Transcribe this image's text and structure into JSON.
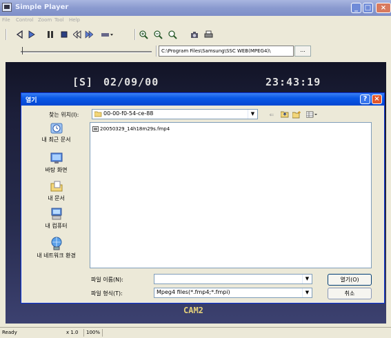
{
  "app": {
    "title": "Simple Player",
    "path": "C:\\Program Files\\Samsung\\SSC WEB(MPEG4)\\",
    "browse_label": "..."
  },
  "window_controls": {
    "minimize": "_",
    "maximize": "□",
    "close": "×"
  },
  "menu": [
    "File",
    "Control",
    "Zoom",
    "Tool",
    "Help"
  ],
  "toolbar_icons": [
    "rewind-icon",
    "play-icon",
    "pause-icon",
    "stop-icon",
    "step-back-icon",
    "step-forward-icon",
    "speed-dropdown-icon",
    "zoom-in-icon",
    "zoom-out-icon",
    "search-icon",
    "snapshot-icon",
    "print-icon"
  ],
  "video": {
    "ch": "[S]",
    "date": "02/09/00",
    "time": "23:43:19",
    "camera": "CAM2"
  },
  "dialog": {
    "title": "열기",
    "help": "?",
    "close": "×",
    "look_in_label": "찾는 위치(I):",
    "look_in_value": "00-00-f0-54-ce-88",
    "places": [
      "내 최근 문서",
      "바탕 화면",
      "내 문서",
      "내 컴퓨터",
      "내 네트워크 환경"
    ],
    "files": [
      "20050329_14h18m29s.fmp4"
    ],
    "filename_label": "파일 이름(N):",
    "filename_value": "",
    "filetype_label": "파일 형식(T):",
    "filetype_value": "Mpeg4 files(*.fmp4;*.fmpi)",
    "open_button": "열기(O)",
    "cancel_button": "취소"
  },
  "status": {
    "state": "Ready",
    "speed": "x 1.0",
    "zoom": "100%"
  }
}
